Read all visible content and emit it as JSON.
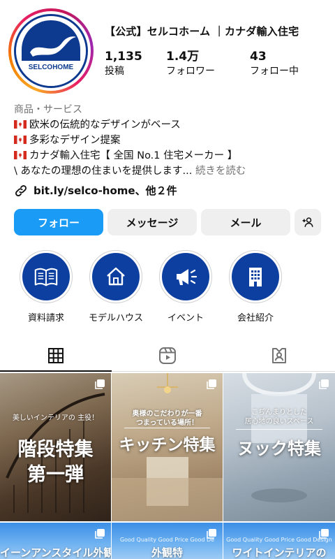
{
  "profile": {
    "username": "【公式】セルコホーム ｜カナダ輸入住宅",
    "logo_text": "SELCOHOME",
    "stats": [
      {
        "value": "1,135",
        "label": "投稿"
      },
      {
        "value": "1.4万",
        "label": "フォロワー"
      },
      {
        "value": "43",
        "label": "フォロー中"
      }
    ]
  },
  "bio": {
    "category": "商品・サービス",
    "lines": [
      "欧米の伝統的なデザインがベース",
      "多彩なデザイン提案",
      "カナダ輸入住宅【 全国 No.1 住宅メーカー 】"
    ],
    "last_line": "\\ あなたの理想の住まいを提供します...",
    "more": "続きを読む",
    "link": "bit.ly/selco-home、他２件"
  },
  "buttons": {
    "follow": "フォロー",
    "message": "メッセージ",
    "mail": "メール"
  },
  "highlights": [
    {
      "label": "資料請求",
      "icon": "book-icon"
    },
    {
      "label": "モデルハウス",
      "icon": "house-icon"
    },
    {
      "label": "イベント",
      "icon": "megaphone-icon"
    },
    {
      "label": "会社紹介",
      "icon": "building-icon"
    }
  ],
  "tabs": [
    {
      "name": "grid",
      "icon": "grid-icon",
      "active": true
    },
    {
      "name": "reels",
      "icon": "reels-icon",
      "active": false
    },
    {
      "name": "tagged",
      "icon": "tagged-icon",
      "active": false
    }
  ],
  "posts": [
    {
      "subtitle": "美しいインテリアの\n主役！",
      "title": "階段特集\n第一弾"
    },
    {
      "subtitle": "奥様のこだわりが一番\nつまっている場所！",
      "title": "キッチン特集"
    },
    {
      "subtitle": "こぢんまりとした\n居心地の良いスペース",
      "title": "ヌック特集"
    },
    {
      "tiny": "",
      "strip": "イーンアンスタイル外観特"
    },
    {
      "tiny": "Good Quality Good Price Good De",
      "strip": "外観特"
    },
    {
      "tiny": "Good Quality Good Price Good Design",
      "strip": "ワイトインテリアの"
    }
  ],
  "colors": {
    "follow_button": "#1a9bf6",
    "brand_blue": "#0d3fa0"
  }
}
